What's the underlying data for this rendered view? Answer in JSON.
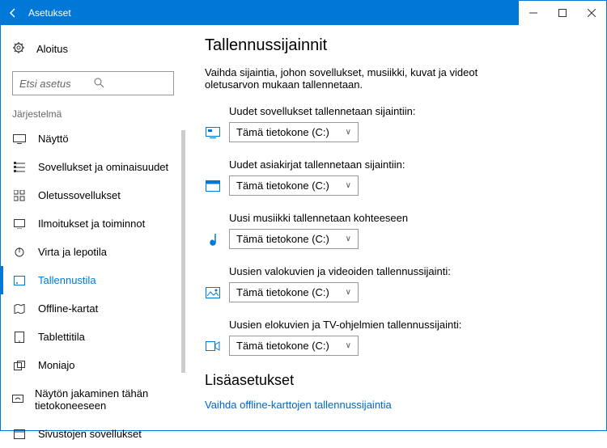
{
  "titlebar": {
    "title": "Asetukset"
  },
  "sidebar": {
    "home": "Aloitus",
    "search_placeholder": "Etsi asetus",
    "category": "Järjestelmä",
    "items": [
      {
        "label": "Näyttö"
      },
      {
        "label": "Sovellukset ja ominaisuudet"
      },
      {
        "label": "Oletussovellukset"
      },
      {
        "label": "Ilmoitukset ja toiminnot"
      },
      {
        "label": "Virta ja lepotila"
      },
      {
        "label": "Tallennustila"
      },
      {
        "label": "Offline-kartat"
      },
      {
        "label": "Tablettitila"
      },
      {
        "label": "Moniajo"
      },
      {
        "label": "Näytön jakaminen tähän tietokoneeseen"
      },
      {
        "label": "Sivustojen sovellukset"
      }
    ]
  },
  "main": {
    "heading": "Tallennussijainnit",
    "description": "Vaihda sijaintia, johon sovellukset, musiikki, kuvat ja videot oletusarvon mukaan tallennetaan.",
    "settings": [
      {
        "label": "Uudet sovellukset tallennetaan sijaintiin:",
        "value": "Tämä tietokone (C:)"
      },
      {
        "label": "Uudet asiakirjat tallennetaan sijaintiin:",
        "value": "Tämä tietokone (C:)"
      },
      {
        "label": "Uusi musiikki tallennetaan kohteeseen",
        "value": "Tämä tietokone (C:)"
      },
      {
        "label": "Uusien valokuvien ja videoiden tallennussijainti:",
        "value": "Tämä tietokone (C:)"
      },
      {
        "label": "Uusien elokuvien ja TV-ohjelmien tallennussijainti:",
        "value": "Tämä tietokone (C:)"
      }
    ],
    "advanced_heading": "Lisäasetukset",
    "offline_link": "Vaihda offline-karttojen tallennussijaintia"
  }
}
